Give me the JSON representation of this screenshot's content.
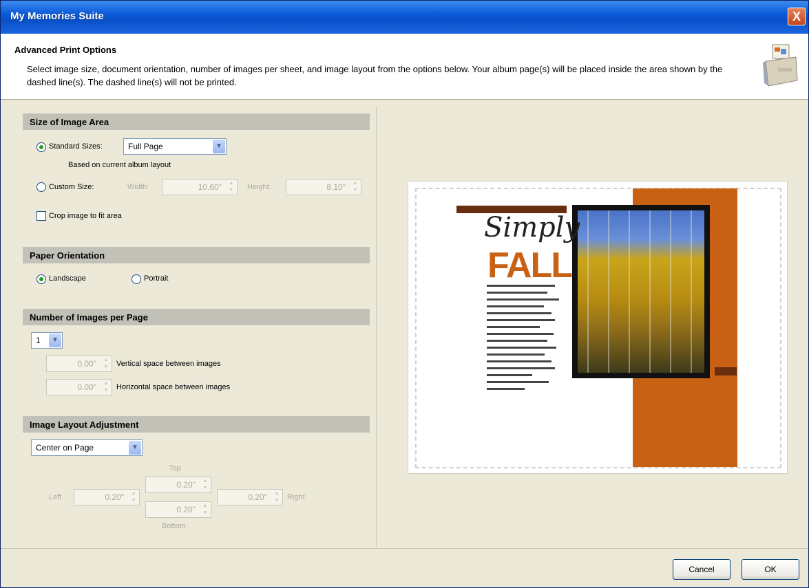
{
  "window": {
    "title": "My Memories Suite",
    "close_glyph": "X"
  },
  "header": {
    "title": "Advanced Print Options",
    "description": "Select image size, document orientation, number of images per sheet, and image layout from the options below. Your album page(s) will be placed inside the area shown by the dashed line(s). The dashed line(s) will not be printed."
  },
  "size": {
    "header": "Size of Image Area",
    "standard_label": "Standard Sizes:",
    "standard_value": "Full Page",
    "standard_note": "Based on current album layout",
    "custom_label": "Custom Size:",
    "width_label": "Width:",
    "width_value": "10.60\"",
    "height_label": "Height:",
    "height_value": "8.10\"",
    "crop_label": "Crop image to fit area"
  },
  "orientation": {
    "header": "Paper Orientation",
    "landscape_label": "Landscape",
    "portrait_label": "Portrait"
  },
  "images": {
    "header": "Number of Images per Page",
    "count": "1",
    "vertical_value": "0.00\"",
    "vertical_label": "Vertical space between images",
    "horizontal_value": "0.00\"",
    "horizontal_label": "Horizontal space between images"
  },
  "layout": {
    "header": "Image Layout Adjustment",
    "mode": "Center on Page",
    "top_label": "Top",
    "top_value": "0.20\"",
    "left_label": "Left",
    "left_value": "0.20\"",
    "right_label": "Right",
    "right_value": "0.20\"",
    "bottom_label": "Bottom",
    "bottom_value": "0.20\""
  },
  "preview": {
    "script_text": "Simply",
    "big_text": "FALL"
  },
  "buttons": {
    "cancel": "Cancel",
    "ok": "OK"
  }
}
